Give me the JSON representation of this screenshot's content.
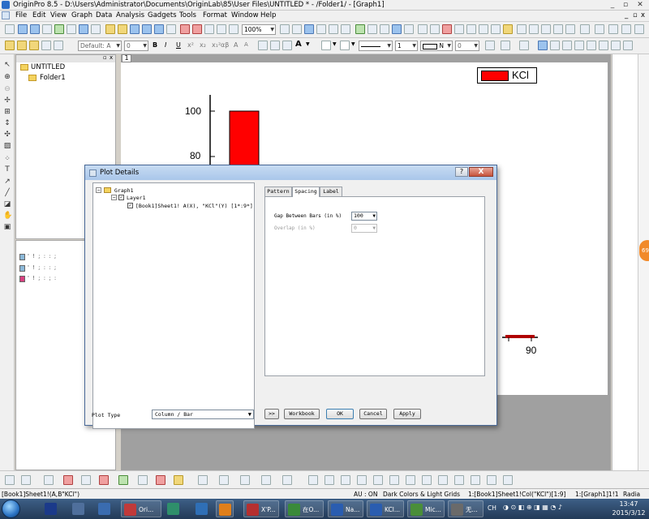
{
  "window": {
    "title": "OriginPro 8.5 - D:\\Users\\Administrator\\Documents\\OriginLab\\85\\User Files\\UNTITLED * - /Folder1/ - [Graph1]"
  },
  "menu": [
    "File",
    "Edit",
    "View",
    "Graph",
    "Data",
    "Analysis",
    "Gadgets",
    "Tools",
    "Format",
    "Window",
    "Help"
  ],
  "toolbar1": {
    "zoom": "100%"
  },
  "toolbar2": {
    "font": "Default: A",
    "font_size": "0",
    "bold": "B",
    "italic": "I",
    "underline": "U",
    "super": "x²",
    "sub": "x₂",
    "super_sub": "x₁²",
    "greek": "αβ",
    "grow": "A",
    "shrink": "A",
    "line_width": "1",
    "n_label": "N",
    "zero_label": "0"
  },
  "project_explorer": {
    "root": "UNTITLED",
    "folder": "Folder1"
  },
  "graph": {
    "page_number": "1",
    "legend_label": "KCl",
    "legend_color": "#ff0000"
  },
  "chart_data": {
    "type": "bar",
    "yticks": [
      80,
      100
    ],
    "xticks": [
      90
    ],
    "bar_color": "#ff0000",
    "legend": [
      "KCl"
    ]
  },
  "dialog": {
    "title": "Plot Details",
    "help": "?",
    "close": "X",
    "tree": {
      "graph": "Graph1",
      "layer": "Layer1",
      "plot": "[Book1]Sheet1! A(X), \"KCl\"(Y) [1*:9*]"
    },
    "tabs": [
      "Pattern",
      "Spacing",
      "Label"
    ],
    "active_tab": "Spacing",
    "gap_label": "Gap Between Bars (in %)",
    "gap_value": "100",
    "overlap_label": "Overlap (in %)",
    "overlap_value": "0",
    "plot_type_label": "Plot Type",
    "plot_type_value": "Column / Bar",
    "buttons": {
      "expand": ">>",
      "workbook": "Workbook",
      "ok": "OK",
      "cancel": "Cancel",
      "apply": "Apply"
    }
  },
  "statusbar": {
    "left": "[Book1]Sheet1!(A,B\"KCl\")",
    "au": "AU : ON",
    "theme": "Dark Colors & Light Grids",
    "cell": "1:[Book1]Sheet1!Col(\"KCl\")[1:9]",
    "graph": "1:[Graph1]1!1",
    "units": "Radia"
  },
  "orange_badge": "69",
  "taskbar": {
    "items": [
      {
        "label": "",
        "color": "#1b3a8a"
      },
      {
        "label": "",
        "color": "#4f6f9c"
      },
      {
        "label": "",
        "color": "#3a6cb0"
      },
      {
        "label": "Ori...",
        "color": "#c03a3a"
      },
      {
        "label": "",
        "color": "#2f8f6b"
      },
      {
        "label": "",
        "color": "#2f6fb6"
      },
      {
        "label": "X'P...",
        "color": "#b53030"
      },
      {
        "label": "在O...",
        "color": "#3a8a3a"
      },
      {
        "label": "Na...",
        "color": "#2a5db0"
      },
      {
        "label": "KCl...",
        "color": "#2a5db0"
      },
      {
        "label": "Mic...",
        "color": "#4a8e3a"
      },
      {
        "label": "无...",
        "color": "#6a6a6a"
      }
    ],
    "lang": "CH",
    "time": "13:47",
    "date": "2015/3/12"
  }
}
